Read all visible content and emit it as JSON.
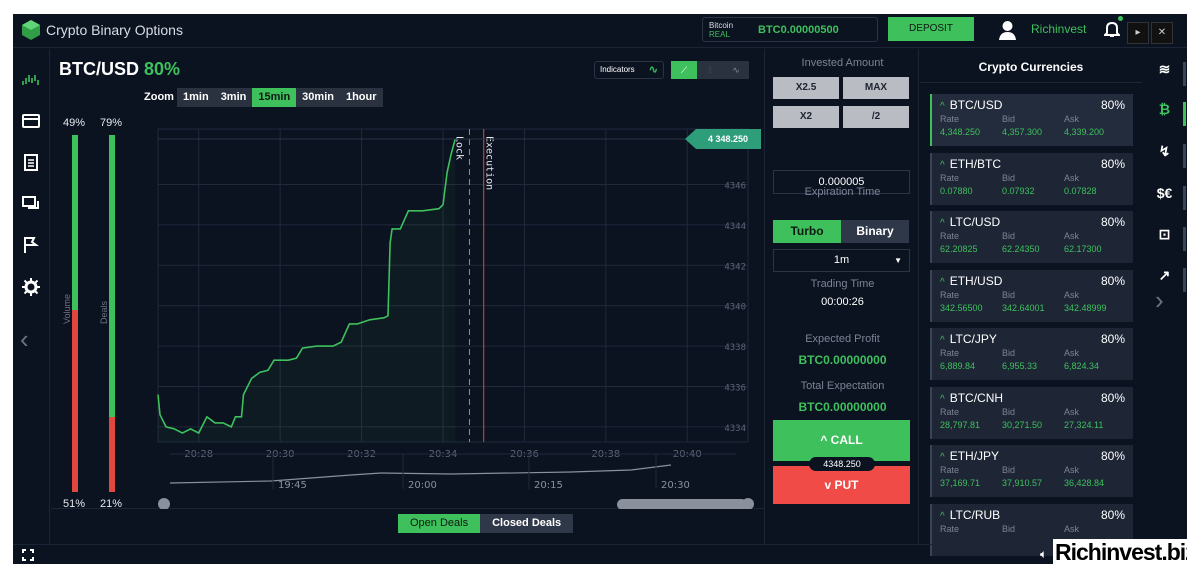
{
  "app": {
    "title": "Crypto Binary Options"
  },
  "header": {
    "balance_currency": "Bitcoin",
    "balance_mode": "REAL",
    "balance_value": "BTC0.00000500",
    "deposit_label": "DEPOSIT",
    "username": "Richinvest"
  },
  "chart": {
    "pair": "BTC/USD",
    "payout": "80%",
    "indicators_label": "Indicators",
    "zoom_label": "Zoom",
    "zoom_options": [
      "1min",
      "3min",
      "15min",
      "30min",
      "1hour"
    ],
    "zoom_selected": "15min",
    "volume": {
      "label": "Volume",
      "up": "49%",
      "down": "51%",
      "up_fraction": 0.49
    },
    "deals": {
      "label": "Deals",
      "up": "79%",
      "down": "21%",
      "up_fraction": 0.79
    },
    "current_price": "4 348.250",
    "lock_label": "Lock",
    "execution_label": "Execution",
    "navigator_labels": [
      "19:45",
      "20:00",
      "20:15",
      "20:30"
    ]
  },
  "chart_data": {
    "type": "line",
    "title": "BTC/USD",
    "x_ticks": [
      "20:28",
      "20:30",
      "20:32",
      "20:34",
      "20:36",
      "20:38",
      "20:40"
    ],
    "y_ticks": [
      4334,
      4336,
      4338,
      4340,
      4342,
      4344,
      4346
    ],
    "ylim": [
      4333.5,
      4348.5
    ],
    "xlim_minutes": [
      27.0,
      41.0
    ],
    "series": [
      {
        "name": "BTC/USD",
        "points": [
          [
            27.0,
            4335.6
          ],
          [
            27.05,
            4334.6
          ],
          [
            27.2,
            4334.0
          ],
          [
            27.4,
            4333.9
          ],
          [
            27.6,
            4333.7
          ],
          [
            27.8,
            4333.9
          ],
          [
            28.0,
            4333.7
          ],
          [
            28.2,
            4334.5
          ],
          [
            28.4,
            4334.2
          ],
          [
            28.6,
            4334.2
          ],
          [
            28.8,
            4334.0
          ],
          [
            28.9,
            4334.5
          ],
          [
            29.05,
            4334.5
          ],
          [
            29.1,
            4335.6
          ],
          [
            29.3,
            4336.4
          ],
          [
            29.5,
            4336.7
          ],
          [
            29.7,
            4336.8
          ],
          [
            29.85,
            4337.3
          ],
          [
            30.0,
            4337.3
          ],
          [
            30.15,
            4337.3
          ],
          [
            30.2,
            4337.3
          ],
          [
            30.4,
            4337.4
          ],
          [
            30.55,
            4337.9
          ],
          [
            30.9,
            4338.0
          ],
          [
            31.3,
            4338.0
          ],
          [
            31.5,
            4338.2
          ],
          [
            31.7,
            4339.1
          ],
          [
            31.9,
            4339.1
          ],
          [
            32.2,
            4339.3
          ],
          [
            32.55,
            4339.4
          ],
          [
            32.65,
            4339.5
          ],
          [
            32.7,
            4343.1
          ],
          [
            32.75,
            4343.8
          ],
          [
            32.95,
            4343.8
          ],
          [
            33.15,
            4344.7
          ],
          [
            33.5,
            4344.7
          ],
          [
            33.9,
            4344.8
          ],
          [
            34.0,
            4345.0
          ],
          [
            34.1,
            4346.6
          ],
          [
            34.2,
            4347.5
          ],
          [
            34.3,
            4348.25
          ]
        ]
      }
    ],
    "lock_time": 34.65,
    "execution_time": 35.0,
    "grid": true
  },
  "deals_tabs": {
    "open": "Open Deals",
    "closed": "Closed Deals"
  },
  "trade": {
    "invested_label": "Invested Amount",
    "buttons": [
      "X2.5",
      "MAX",
      "X2",
      "/2"
    ],
    "amount": "0.000005",
    "expiration_label": "Expiration Time",
    "turbo": "Turbo",
    "binary": "Binary",
    "expiry_value": "1m",
    "trading_time_label": "Trading Time",
    "trading_time": "00:00:26",
    "profit_label": "Expected Profit",
    "profit_value": "BTC0.00000000",
    "total_label": "Total Expectation",
    "total_value": "BTC0.00000000",
    "call": "^ CALL",
    "put": "v PUT",
    "price": "4348.250"
  },
  "markets": {
    "title": "Crypto Currencies",
    "headers": [
      "Rate",
      "Bid",
      "Ask"
    ],
    "items": [
      {
        "name": "BTC/USD",
        "pct": "80%",
        "rate": "4,348.250",
        "bid": "4,357.300",
        "ask": "4,339.200"
      },
      {
        "name": "ETH/BTC",
        "pct": "80%",
        "rate": "0.07880",
        "bid": "0.07932",
        "ask": "0.07828"
      },
      {
        "name": "LTC/USD",
        "pct": "80%",
        "rate": "62.20825",
        "bid": "62.24350",
        "ask": "62.17300"
      },
      {
        "name": "ETH/USD",
        "pct": "80%",
        "rate": "342.56500",
        "bid": "342.64001",
        "ask": "342.48999"
      },
      {
        "name": "LTC/JPY",
        "pct": "80%",
        "rate": "6,889.84",
        "bid": "6,955.33",
        "ask": "6,824.34"
      },
      {
        "name": "BTC/CNH",
        "pct": "80%",
        "rate": "28,797.81",
        "bid": "30,271.50",
        "ask": "27,324.11"
      },
      {
        "name": "ETH/JPY",
        "pct": "80%",
        "rate": "37,169.71",
        "bid": "37,910.57",
        "ask": "36,428.84"
      },
      {
        "name": "LTC/RUB",
        "pct": "80%",
        "rate": "",
        "bid": "",
        "ask": ""
      }
    ]
  },
  "right_nav": {
    "items": [
      "layers-icon",
      "bitcoin-icon",
      "chart-icon",
      "currency-icon",
      "commodity-icon",
      "stocks-icon"
    ],
    "active": "bitcoin-icon"
  },
  "watermark": "Richinvest.biz",
  "colors": {
    "accent": "#3ec05c",
    "danger": "#f04b46",
    "background": "#0b1220"
  }
}
